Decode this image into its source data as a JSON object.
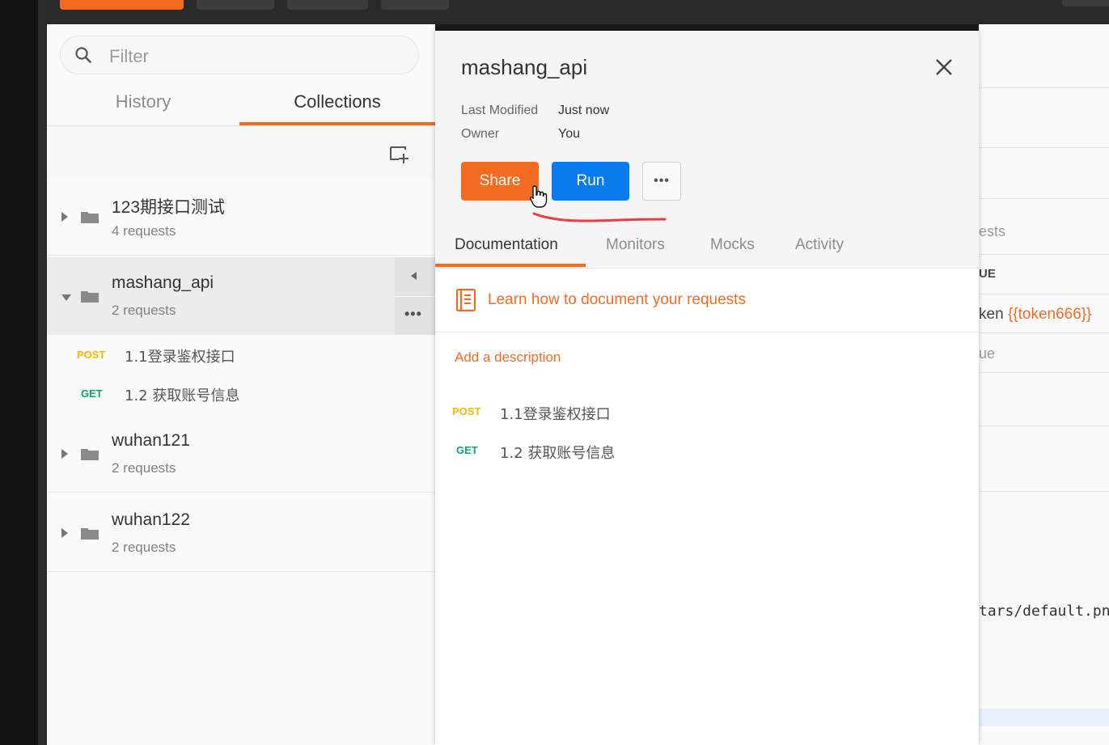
{
  "sidebar": {
    "filter_placeholder": "Filter",
    "tabs": {
      "history": "History",
      "collections": "Collections"
    },
    "collections": [
      {
        "name": "123期接口测试",
        "count": "4 requests",
        "expanded": false
      },
      {
        "name": "mashang_api",
        "count": "2 requests",
        "expanded": true
      },
      {
        "name": "wuhan121",
        "count": "2 requests",
        "expanded": false
      },
      {
        "name": "wuhan122",
        "count": "2 requests",
        "expanded": false
      }
    ],
    "requests": [
      {
        "method": "POST",
        "name": "1.1登录鉴权接口"
      },
      {
        "method": "GET",
        "name": "1.2 获取账号信息"
      }
    ]
  },
  "panel": {
    "title": "mashang_api",
    "meta": {
      "last_modified_label": "Last Modified",
      "last_modified_value": "Just now",
      "owner_label": "Owner",
      "owner_value": "You"
    },
    "buttons": {
      "share": "Share",
      "run": "Run",
      "more": "•••"
    },
    "tabs": [
      "Documentation",
      "Monitors",
      "Mocks",
      "Activity"
    ],
    "learn_link": "Learn how to document your requests",
    "add_description": "Add a description",
    "requests": [
      {
        "method": "POST",
        "name": "1.1登录鉴权接口"
      },
      {
        "method": "GET",
        "name": "1.2 获取账号信息"
      }
    ]
  },
  "right": {
    "frag_requests": "ests",
    "frag_value_header": "UE",
    "frag_token_prefix": "ken ",
    "frag_token_var": "{{token666}}",
    "frag_value": "ue",
    "frag_url": "tars/default.png"
  },
  "colors": {
    "accent": "#f26b21",
    "run_blue": "#097bed",
    "post": "#f5b800",
    "get": "#0fa36b"
  }
}
